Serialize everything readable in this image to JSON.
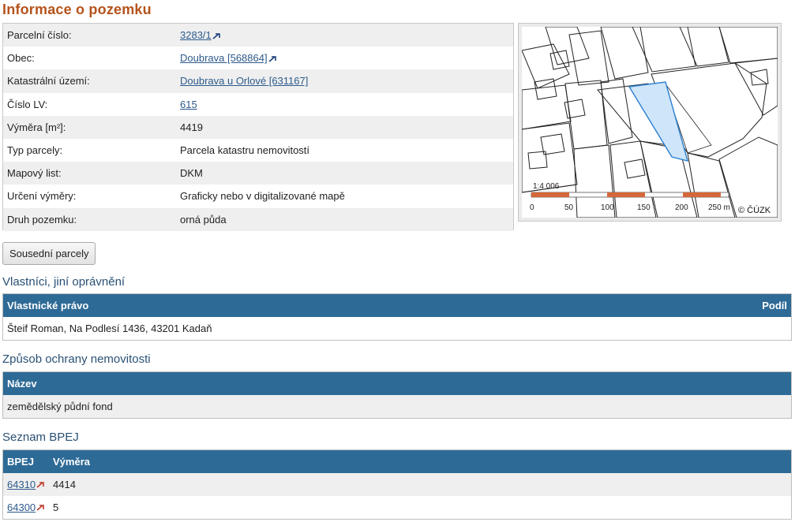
{
  "page_title": "Informace o pozemku",
  "parcel_info": [
    {
      "label": "Parcelní číslo:",
      "value": "3283/1",
      "link": true,
      "ext": true
    },
    {
      "label": "Obec:",
      "value": "Doubrava [568864]",
      "link": true,
      "ext": true
    },
    {
      "label": "Katastrální území:",
      "value": "Doubrava u Orlové [631167]",
      "link": true,
      "ext": false
    },
    {
      "label": "Číslo LV:",
      "value": "615",
      "link": true,
      "ext": false
    },
    {
      "label": "Výměra [m²]:",
      "value": "4419",
      "link": false,
      "ext": false
    },
    {
      "label": "Typ parcely:",
      "value": "Parcela katastru nemovitostí",
      "link": false,
      "ext": false
    },
    {
      "label": "Mapový list:",
      "value": "DKM",
      "link": false,
      "ext": false
    },
    {
      "label": "Určení výměry:",
      "value": "Graficky nebo v digitalizované mapě",
      "link": false,
      "ext": false
    },
    {
      "label": "Druh pozemku:",
      "value": "orná půda",
      "link": false,
      "ext": false
    }
  ],
  "map": {
    "scale_label": "1:4 006",
    "scale_ticks": [
      "0",
      "50",
      "100",
      "150",
      "200",
      "250 m"
    ],
    "copyright": "© ČÚZK",
    "parcel_color": "#cfe5fa",
    "scale_color": "#d4683a"
  },
  "neighbors_button": "Sousední parcely",
  "owners": {
    "heading": "Vlastníci, jiní oprávnění",
    "col_right": "Vlastnické právo",
    "col_share": "Podíl",
    "rows": [
      {
        "owner": "Šteif Roman, Na Podlesí 1436, 43201 Kadaň"
      }
    ]
  },
  "protection": {
    "heading": "Způsob ochrany nemovitosti",
    "col_name": "Název",
    "rows": [
      {
        "name": "zemědělský půdní fond"
      }
    ]
  },
  "bpej": {
    "heading": "Seznam BPEJ",
    "col_code": "BPEJ",
    "col_area": "Výměra",
    "rows": [
      {
        "code": "64310",
        "area": "4414"
      },
      {
        "code": "64300",
        "area": "5"
      }
    ]
  }
}
